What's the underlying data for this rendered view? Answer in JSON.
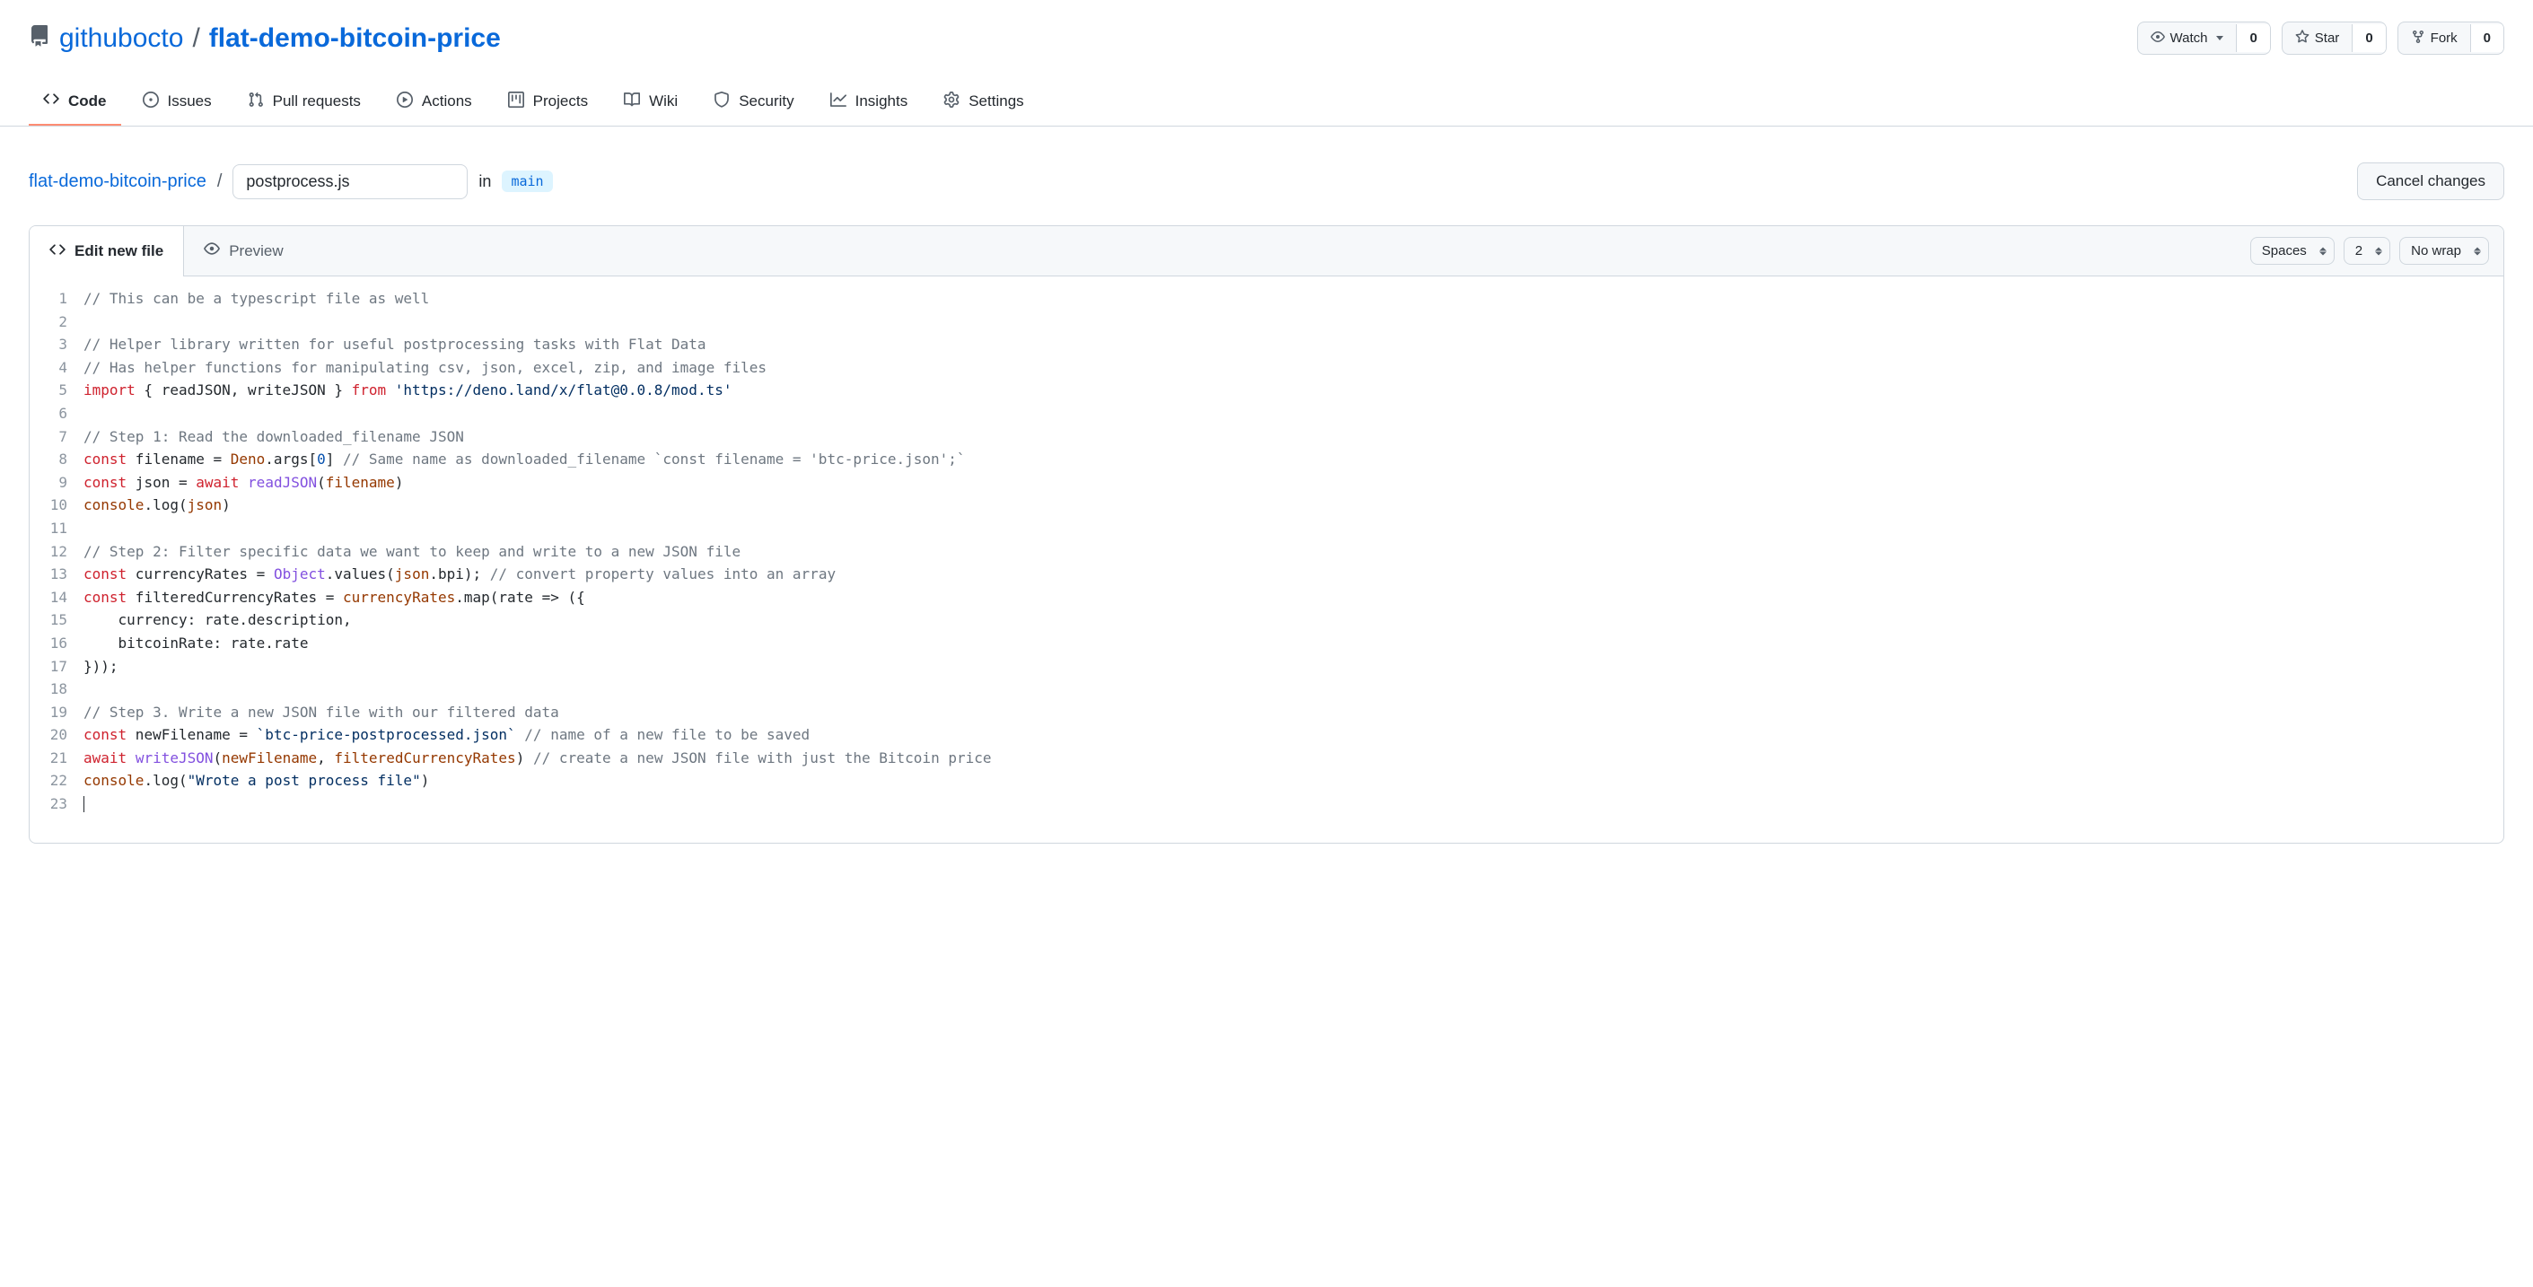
{
  "repo": {
    "owner": "githubocto",
    "name": "flat-demo-bitcoin-price"
  },
  "repo_actions": {
    "watch_label": "Watch",
    "watch_count": "0",
    "star_label": "Star",
    "star_count": "0",
    "fork_label": "Fork",
    "fork_count": "0"
  },
  "nav": {
    "code": "Code",
    "issues": "Issues",
    "pull_requests": "Pull requests",
    "actions": "Actions",
    "projects": "Projects",
    "wiki": "Wiki",
    "security": "Security",
    "insights": "Insights",
    "settings": "Settings"
  },
  "path": {
    "repo_link": "flat-demo-bitcoin-price",
    "filename_value": "postprocess.js",
    "in_label": "in",
    "branch": "main",
    "cancel_label": "Cancel changes"
  },
  "editor": {
    "tab_edit": "Edit new file",
    "tab_preview": "Preview",
    "indent_mode": "Spaces",
    "indent_size": "2",
    "wrap_mode": "No wrap"
  },
  "code": {
    "line1": "// This can be a typescript file as well",
    "line3": "// Helper library written for useful postprocessing tasks with Flat Data",
    "line4": "// Has helper functions for manipulating csv, json, excel, zip, and image files",
    "line5_import": "import",
    "line5_names": " { readJSON, writeJSON } ",
    "line5_from": "from",
    "line5_path": " 'https://deno.land/x/flat@0.0.8/mod.ts'",
    "line7": "// Step 1: Read the downloaded_filename JSON",
    "line8_const": "const",
    "line8_var": " filename = ",
    "line8_deno": "Deno",
    "line8_args": ".args[",
    "line8_zero": "0",
    "line8_close": "] ",
    "line8_comment": "// Same name as downloaded_filename `const filename = 'btc-price.json';`",
    "line9_const": "const",
    "line9_a": " json = ",
    "line9_await": "await",
    "line9_sp": " ",
    "line9_fn": "readJSON",
    "line9_open": "(",
    "line9_arg": "filename",
    "line9_close": ")",
    "line10_a": "console",
    "line10_b": ".log(",
    "line10_arg": "json",
    "line10_c": ")",
    "line12": "// Step 2: Filter specific data we want to keep and write to a new JSON file",
    "line13_const": "const",
    "line13_a": " currencyRates = ",
    "line13_obj": "Object",
    "line13_b": ".values(",
    "line13_json": "json",
    "line13_c": ".bpi); ",
    "line13_comment": "// convert property values into an array",
    "line14_const": "const",
    "line14_a": " filteredCurrencyRates = ",
    "line14_var": "currencyRates",
    "line14_b": ".map(rate => ({",
    "line15": "    currency: rate.description,",
    "line16": "    bitcoinRate: rate.rate",
    "line17": "}));",
    "line19": "// Step 3. Write a new JSON file with our filtered data",
    "line20_const": "const",
    "line20_a": " newFilename = ",
    "line20_str": "`btc-price-postprocessed.json`",
    "line20_sp": " ",
    "line20_comment": "// name of a new file to be saved",
    "line21_await": "await",
    "line21_sp": " ",
    "line21_fn": "writeJSON",
    "line21_open": "(",
    "line21_a1": "newFilename",
    "line21_comma": ", ",
    "line21_a2": "filteredCurrencyRates",
    "line21_close": ") ",
    "line21_comment": "// create a new JSON file with just the Bitcoin price",
    "line22_a": "console",
    "line22_b": ".log(",
    "line22_str": "\"Wrote a post process file\"",
    "line22_c": ")"
  }
}
